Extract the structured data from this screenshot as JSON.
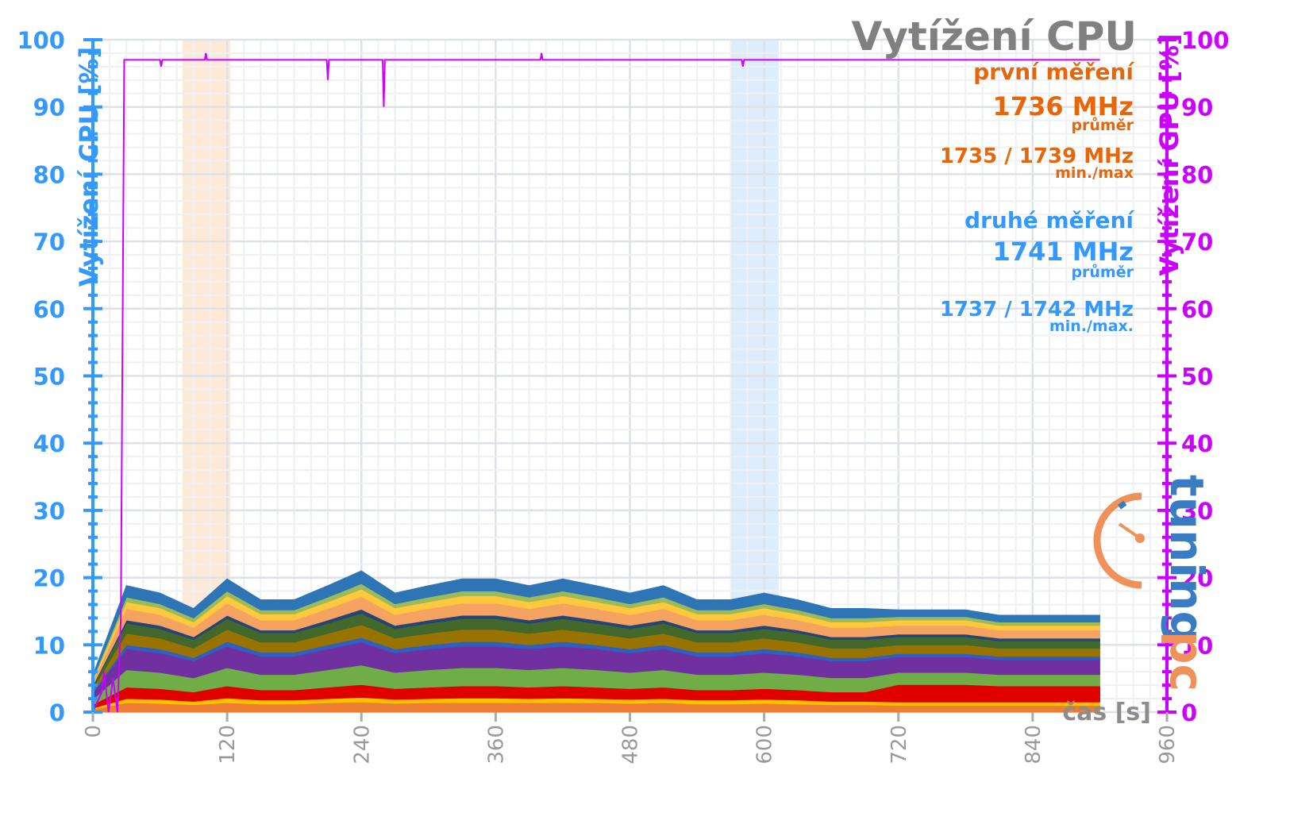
{
  "chart_data": {
    "type": "area",
    "title": "Vytížení CPU",
    "xlabel": "čas [s]",
    "ylabel": "Vytížení CPU [%]",
    "y2label": "Vytížení GPU [%]",
    "xlim": [
      0,
      960
    ],
    "ylim": [
      0,
      100
    ],
    "y2lim": [
      0,
      100
    ],
    "xticks": [
      0,
      120,
      240,
      360,
      480,
      600,
      720,
      840,
      960
    ],
    "yticks": [
      0,
      10,
      20,
      30,
      40,
      50,
      60,
      70,
      80,
      90,
      100
    ],
    "grid": true,
    "stacked": true,
    "colors": {
      "left_axis": "#3399ff",
      "right_axis": "#cc00ff",
      "title": "#808080",
      "first": "#e8660a",
      "second": "#3399ff"
    },
    "highlights": [
      {
        "from": 80,
        "to": 123,
        "color": "#fbe3cc"
      },
      {
        "from": 570,
        "to": 613,
        "color": "#d6e8fb"
      }
    ],
    "annotations": {
      "first_label": "první měření",
      "first_avg": "1736 MHz",
      "first_avg_sub": "průměr",
      "first_minmax": "1735 / 1739 MHz",
      "first_minmax_sub": "min./max",
      "second_label": "druhé měření",
      "second_avg": "1741 MHz",
      "second_avg_sub": "průměr",
      "second_minmax": "1737 / 1742 MHz",
      "second_minmax_sub": "min./max."
    },
    "x": [
      0,
      30,
      60,
      90,
      120,
      150,
      180,
      210,
      240,
      270,
      300,
      330,
      360,
      390,
      420,
      450,
      480,
      510,
      540,
      570,
      600,
      630,
      660,
      690,
      720,
      750,
      780,
      810,
      840,
      870,
      900
    ],
    "series": [
      {
        "color": "#ed7d31",
        "values": [
          0.4,
          1.4,
          1.3,
          1.1,
          1.4,
          1.2,
          1.2,
          1.4,
          1.5,
          1.3,
          1.4,
          1.4,
          1.4,
          1.4,
          1.4,
          1.4,
          1.3,
          1.4,
          1.2,
          1.2,
          1.3,
          1.2,
          1.1,
          1.1,
          1.0,
          1.0,
          1.0,
          1.0,
          1.0,
          1.0,
          1.0
        ]
      },
      {
        "color": "#ffc000",
        "values": [
          0.2,
          0.6,
          0.6,
          0.5,
          0.7,
          0.6,
          0.6,
          0.6,
          0.7,
          0.6,
          0.6,
          0.7,
          0.7,
          0.6,
          0.7,
          0.6,
          0.6,
          0.6,
          0.6,
          0.6,
          0.6,
          0.6,
          0.5,
          0.5,
          0.5,
          0.5,
          0.5,
          0.5,
          0.5,
          0.5,
          0.5
        ]
      },
      {
        "color": "#e00000",
        "values": [
          0.5,
          1.7,
          1.6,
          1.4,
          1.8,
          1.5,
          1.5,
          1.7,
          1.9,
          1.6,
          1.7,
          1.8,
          1.8,
          1.7,
          1.8,
          1.7,
          1.6,
          1.7,
          1.5,
          1.5,
          1.6,
          1.5,
          1.4,
          1.4,
          2.6,
          2.6,
          2.6,
          2.4,
          2.4,
          2.4,
          2.4
        ]
      },
      {
        "color": "#70ad47",
        "values": [
          0.8,
          2.6,
          2.4,
          2.1,
          2.7,
          2.3,
          2.3,
          2.6,
          2.9,
          2.4,
          2.6,
          2.7,
          2.7,
          2.6,
          2.7,
          2.6,
          2.4,
          2.6,
          2.3,
          2.3,
          2.4,
          2.3,
          2.1,
          2.1,
          1.8,
          1.8,
          1.8,
          1.7,
          1.7,
          1.7,
          1.7
        ]
      },
      {
        "color": "#7030a0",
        "values": [
          0.9,
          3.1,
          2.9,
          2.5,
          3.2,
          2.7,
          2.7,
          3.1,
          3.4,
          2.9,
          3.1,
          3.2,
          3.2,
          3.1,
          3.2,
          3.1,
          2.9,
          3.1,
          2.7,
          2.7,
          2.9,
          2.7,
          2.5,
          2.5,
          2.3,
          2.3,
          2.3,
          2.2,
          2.2,
          2.2,
          2.2
        ]
      },
      {
        "color": "#2f5fc0",
        "values": [
          0.2,
          0.6,
          0.6,
          0.5,
          0.7,
          0.6,
          0.6,
          0.6,
          0.7,
          0.6,
          0.6,
          0.7,
          0.7,
          0.6,
          0.7,
          0.6,
          0.6,
          0.6,
          0.6,
          0.6,
          0.6,
          0.6,
          0.5,
          0.5,
          0.5,
          0.5,
          0.5,
          0.5,
          0.5,
          0.5,
          0.5
        ]
      },
      {
        "color": "#997300",
        "values": [
          0.5,
          1.7,
          1.6,
          1.4,
          1.8,
          1.5,
          1.5,
          1.7,
          1.9,
          1.6,
          1.7,
          1.8,
          1.8,
          1.7,
          1.8,
          1.7,
          1.6,
          1.7,
          1.5,
          1.5,
          1.6,
          1.5,
          1.4,
          1.4,
          1.3,
          1.3,
          1.3,
          1.2,
          1.2,
          1.2,
          1.2
        ]
      },
      {
        "color": "#43682b",
        "values": [
          0.4,
          1.5,
          1.4,
          1.3,
          1.6,
          1.4,
          1.4,
          1.5,
          1.7,
          1.4,
          1.5,
          1.6,
          1.6,
          1.5,
          1.6,
          1.5,
          1.4,
          1.5,
          1.4,
          1.4,
          1.4,
          1.4,
          1.3,
          1.3,
          1.2,
          1.2,
          1.2,
          1.1,
          1.1,
          1.1,
          1.1
        ]
      },
      {
        "color": "#264478",
        "values": [
          0.1,
          0.5,
          0.5,
          0.4,
          0.5,
          0.4,
          0.4,
          0.5,
          0.6,
          0.5,
          0.5,
          0.5,
          0.5,
          0.5,
          0.5,
          0.5,
          0.5,
          0.5,
          0.4,
          0.4,
          0.5,
          0.4,
          0.4,
          0.4,
          0.4,
          0.4,
          0.4,
          0.4,
          0.4,
          0.4,
          0.4
        ]
      },
      {
        "color": "#f4a460",
        "values": [
          0.5,
          1.7,
          1.6,
          1.4,
          1.8,
          1.5,
          1.5,
          1.7,
          1.9,
          1.6,
          1.7,
          1.8,
          1.8,
          1.7,
          1.8,
          1.7,
          1.6,
          1.7,
          1.5,
          1.5,
          1.6,
          1.5,
          1.4,
          1.4,
          1.3,
          1.3,
          1.3,
          1.2,
          1.2,
          1.2,
          1.2
        ]
      },
      {
        "color": "#ffc83d",
        "values": [
          0.3,
          1.0,
          1.0,
          0.8,
          1.1,
          0.9,
          0.9,
          1.0,
          1.1,
          1.0,
          1.0,
          1.1,
          1.1,
          1.0,
          1.1,
          1.0,
          1.0,
          1.0,
          0.9,
          0.9,
          1.0,
          0.9,
          0.8,
          0.8,
          0.8,
          0.8,
          0.8,
          0.7,
          0.7,
          0.7,
          0.7
        ]
      },
      {
        "color": "#9bbb59",
        "values": [
          0.2,
          0.7,
          0.6,
          0.6,
          0.7,
          0.6,
          0.6,
          0.7,
          0.8,
          0.6,
          0.7,
          0.7,
          0.7,
          0.7,
          0.7,
          0.7,
          0.6,
          0.7,
          0.6,
          0.6,
          0.6,
          0.6,
          0.6,
          0.6,
          0.5,
          0.5,
          0.5,
          0.5,
          0.5,
          0.5,
          0.5
        ]
      },
      {
        "color": "#2e75b6",
        "values": [
          0.5,
          1.7,
          1.6,
          1.4,
          1.8,
          1.5,
          1.5,
          1.7,
          1.9,
          1.6,
          1.7,
          1.8,
          1.8,
          1.7,
          1.8,
          1.7,
          1.6,
          1.7,
          1.5,
          1.5,
          1.6,
          1.5,
          1.4,
          1.4,
          1.0,
          1.0,
          1.0,
          1.0,
          1.0,
          1.0,
          1.0
        ]
      }
    ],
    "gpu_series": {
      "color": "#cc00ff",
      "x": [
        0,
        8,
        10,
        14,
        18,
        22,
        25,
        28,
        60,
        61,
        62,
        100,
        101,
        102,
        209,
        210,
        211,
        259,
        260,
        261,
        400,
        401,
        402,
        580,
        581,
        582,
        900
      ],
      "y": [
        0,
        3,
        6,
        0,
        5,
        0,
        14,
        97,
        97,
        96,
        97,
        97,
        98,
        97,
        97,
        94,
        97,
        97,
        90,
        97,
        97,
        98,
        97,
        97,
        96,
        97,
        97
      ]
    }
  },
  "logo": {
    "text": "pctuning"
  }
}
